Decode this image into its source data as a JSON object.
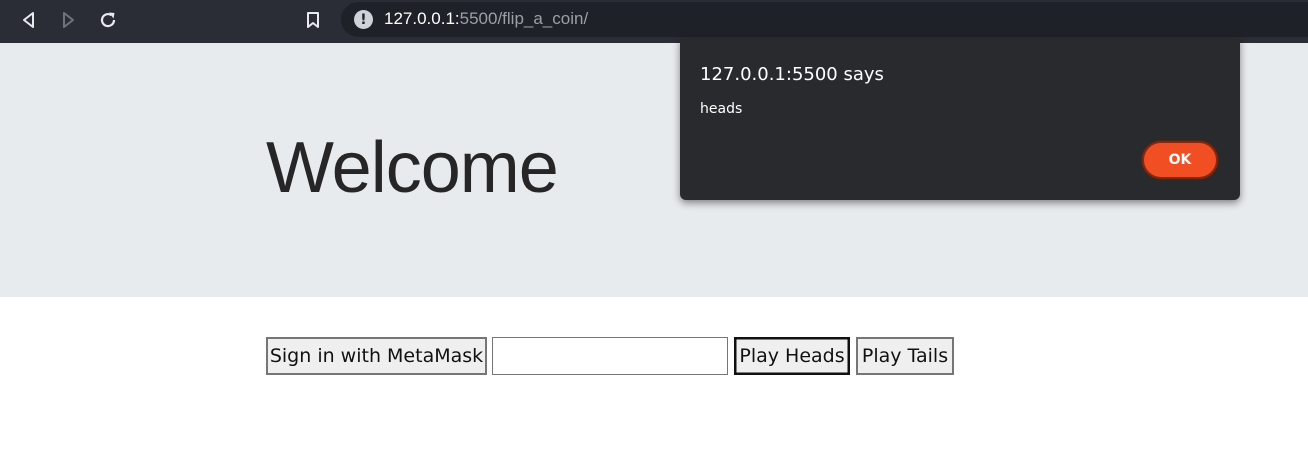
{
  "browser": {
    "back_icon": "back-arrow-icon",
    "forward_icon": "forward-arrow-icon",
    "reload_icon": "reload-icon",
    "bookmark_icon": "bookmark-icon",
    "site_info_icon": "info-icon",
    "site_info_glyph": "!",
    "url_host": "127.0.0.1:",
    "url_path": "5500/flip_a_coin/"
  },
  "page": {
    "heading": "Welcome",
    "signin_label": "Sign in with MetaMask",
    "amount_value": "",
    "play_heads_label": "Play Heads",
    "play_tails_label": "Play Tails"
  },
  "alert": {
    "title": "127.0.0.1:5500 says",
    "message": "heads",
    "ok_label": "OK"
  },
  "colors": {
    "toolbar_bg": "#2b2d36",
    "jumbotron_bg": "#e8ebee",
    "dialog_bg": "#292a2d",
    "ok_button": "#f24e23"
  }
}
